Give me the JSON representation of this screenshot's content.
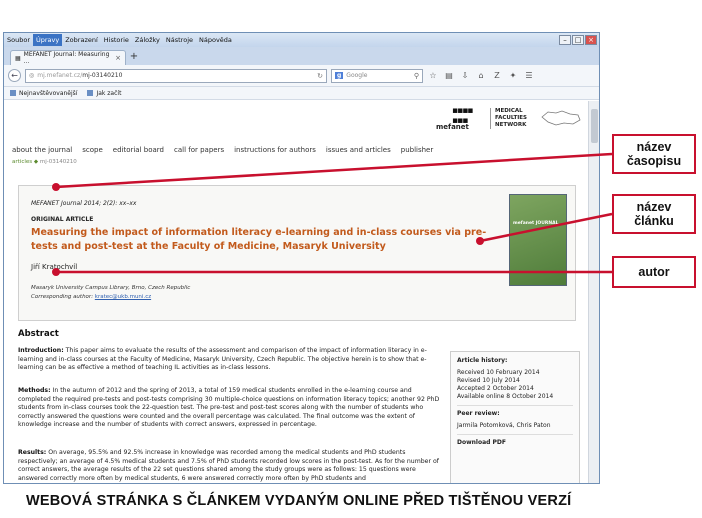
{
  "browser": {
    "menu": [
      "Soubor",
      "Úpravy",
      "Zobrazení",
      "Historie",
      "Záložky",
      "Nástroje",
      "Nápověda"
    ],
    "tab_title": "MEFANET Journal: Measuring ...",
    "url_gray": "mj.mefanet.cz/",
    "url": "mj-03140210",
    "search_placeholder": "Google",
    "bookmarks": [
      "Nejnavštěvovanější",
      "Jak začít"
    ]
  },
  "site": {
    "logo": "mefanet",
    "network": [
      "MEDICAL",
      "FACULTIES",
      "NETWORK"
    ],
    "nav": [
      "about the journal",
      "scope",
      "editorial board",
      "call for papers",
      "instructions for authors",
      "issues and articles",
      "publisher"
    ],
    "breadcrumb_parent": "articles",
    "breadcrumb_current": "mj-03140210"
  },
  "article": {
    "journal": "MEFANET Journal",
    "citation_rest": "2014; 2(2): xx–xx",
    "type": "ORIGINAL ARTICLE",
    "title": "Measuring the impact of information literacy e-learning and in-class courses via pre-tests and post-test at the Faculty of Medicine, Masaryk University",
    "author": "Jiří Kratochvíl",
    "affiliation": "Masaryk University Campus Library, Brno, Czech Republic",
    "corresponding_label": "Corresponding author:",
    "corresponding_email": "kratec@ukb.muni.cz",
    "cover_title": "mefanet JOURNAL"
  },
  "abstract": {
    "heading": "Abstract",
    "intro_label": "Introduction:",
    "intro": "This paper aims to evaluate the results of the assessment and comparison of the impact of information literacy in e-learning and in-class courses at the Faculty of Medicine, Masaryk University, Czech Republic. The objective herein is to show that e-learning can be as effective a method of teaching IL activities as in-class lessons.",
    "methods_label": "Methods:",
    "methods": "In the autumn of 2012 and the spring of 2013, a total of 159 medical students enrolled in the e-learning course and completed the required pre-tests and post-tests comprising 30 multiple-choice questions on information literacy topics; another 92 PhD students from in-class courses took the 22-question test. The pre-test and post-test scores along with the number of students who correctly answered the questions were counted and the overall percentage was calculated. The final outcome was the extent of knowledge increase and the number of students with correct answers, expressed in percentage.",
    "results_label": "Results:",
    "results": "On average, 95.5% and 92.5% increase in knowledge was recorded among the medical students and PhD students respectively; an average of 4.5% medical students and 7.5% of PhD students recorded low scores in the post-test. As for the number of correct answers, the average results of the 22 set questions shared among the study groups were as follows: 15 questions were answered correctly more often by medical students, 6 were answered correctly more often by PhD students and"
  },
  "history": {
    "heading": "Article history:",
    "received": "Received 10 February 2014",
    "revised": "Revised 10 July 2014",
    "accepted": "Accepted 2 October 2014",
    "available": "Available online 8 October 2014",
    "peer_heading": "Peer review:",
    "peer": "Jarmila Potomková, Chris Paton",
    "download": "Download PDF"
  },
  "callouts": {
    "journal_name": [
      "název",
      "časopisu"
    ],
    "article_name": [
      "název",
      "článku"
    ],
    "author": [
      "autor"
    ]
  },
  "caption": "WEBOVÁ STRÁNKA S ČLÁNKEM VYDANÝM ONLINE PŘED TIŠTĚNOU VERZÍ"
}
